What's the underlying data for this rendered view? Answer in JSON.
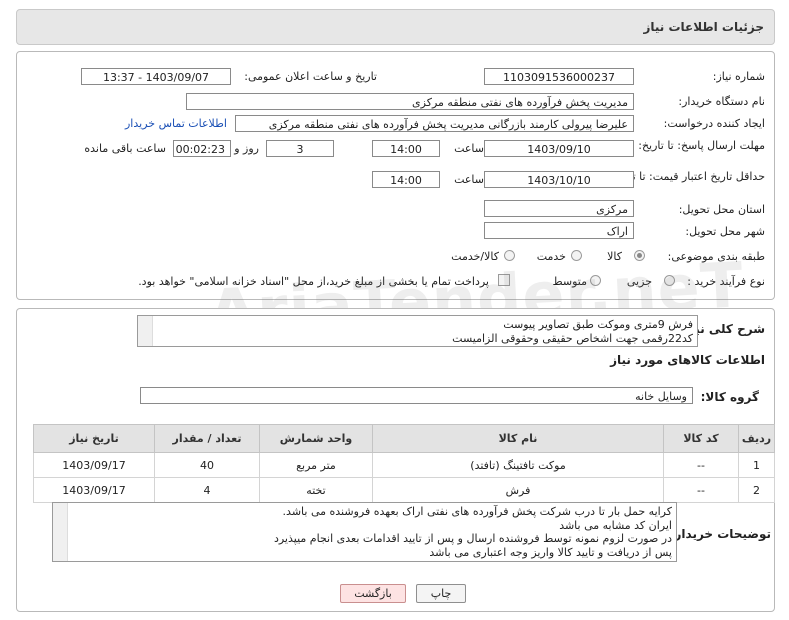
{
  "header": {
    "title": "جزئیات اطلاعات نیاز"
  },
  "fields": {
    "need_number_label": "شماره نیاز:",
    "need_number": "1103091536000237",
    "announce_label": "تاریخ و ساعت اعلان عمومی:",
    "announce_value": "1403/09/07 - 13:37",
    "buyer_label": "نام دستگاه خریدار:",
    "buyer_value": "مدیریت پخش فرآورده های نفتی منطقه مرکزی",
    "creator_label": "ایجاد کننده درخواست:",
    "creator_value": "علیرضا پیرولی کارمند بازرگانی مدیریت پخش فرآورده های نفتی منطقه مرکزی",
    "contact_link": "اطلاعات تماس خریدار",
    "deadline_label": "مهلت ارسال پاسخ: تا تاریخ:",
    "deadline_date": "1403/09/10",
    "time_label": "ساعت",
    "deadline_time": "14:00",
    "days_value": "3",
    "days_label": "روز و",
    "remain_time": "00:02:23",
    "remain_label": "ساعت باقی مانده",
    "price_label": "حداقل تاریخ اعتبار قیمت: تا تاریخ:",
    "price_date": "1403/10/10",
    "price_time": "14:00",
    "province_label": "استان محل تحویل:",
    "province_value": "مرکزی",
    "city_label": "شهر محل تحویل:",
    "city_value": "اراک",
    "category_label": "طبقه بندی موضوعی:",
    "cat_goods": "کالا",
    "cat_service": "خدمت",
    "cat_goods_service": "کالا/خدمت",
    "process_label": "نوع فرآیند خرید :",
    "proc_partial": "جزیی",
    "proc_medium": "متوسط",
    "proc_note": "پرداخت تمام یا بخشی از مبلغ خرید،از محل \"اسناد خزانه اسلامی\" خواهد بود."
  },
  "summary": {
    "label": "شرح کلی نیاز:",
    "line1": "فرش 9متری وموکت طبق تصاویر پیوست",
    "line2": "کد22رقمی  جهت اشخاص حقیقی وحقوقی الزامیست"
  },
  "goods": {
    "section_title": "اطلاعات کالاهای مورد نیاز",
    "group_label": "گروه کالا:",
    "group_value": "وسایل خانه",
    "columns": [
      "ردیف",
      "کد کالا",
      "نام کالا",
      "واحد شمارش",
      "تعداد / مقدار",
      "تاریخ نیاز"
    ],
    "rows": [
      [
        "1",
        "--",
        "موکت تافتینگ (تافتد)",
        "متر مربع",
        "40",
        "1403/09/17"
      ],
      [
        "2",
        "--",
        "فرش",
        "تخته",
        "4",
        "1403/09/17"
      ]
    ]
  },
  "notes": {
    "label": "توضیحات خریدار:",
    "line1": "کرایه حمل بار تا درب شرکت  پخش فرآورده های نفتی اراک بعهده فروشنده می باشد.",
    "line2": "ایران کد مشابه می باشد",
    "line3": "در صورت لزوم نمونه توسط فروشنده ارسال و پس از تایید اقدامات بعدی انجام میپذیرد",
    "line4": "پس از دریافت و تایید کالا واریز وجه اعتباری می باشد"
  },
  "buttons": {
    "print": "چاپ",
    "back": "بازگشت"
  },
  "watermark": "AriaTender.neT",
  "colors": {
    "link": "#1a4fb5",
    "back_bg": "#fde3e3",
    "header_bg": "#e7e7e7"
  }
}
